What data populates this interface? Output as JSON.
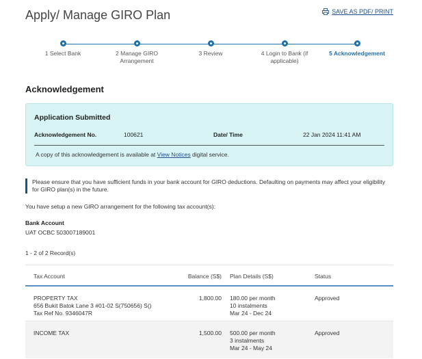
{
  "header": {
    "title": "Apply/ Manage GIRO Plan",
    "save_label": "SAVE AS PDF/ PRINT"
  },
  "stepper": {
    "steps": [
      {
        "line1": "1 Select Bank",
        "line2": ""
      },
      {
        "line1": "2 Manage GIRO",
        "line2": "Arrangement"
      },
      {
        "line1": "3 Review",
        "line2": ""
      },
      {
        "line1": "4 Login to Bank (if",
        "line2": "applicable)"
      },
      {
        "line1": "5 Acknowledgement",
        "line2": ""
      }
    ],
    "active_index": 4,
    "color": "#1f6fa8"
  },
  "section_title": "Acknowledgement",
  "ack": {
    "title": "Application Submitted",
    "ack_no_label": "Acknowledgement No.",
    "ack_no_value": "100621",
    "datetime_label": "Date/ Time",
    "datetime_value": "22 Jan 2024 11:41 AM",
    "note_before": "A copy of this acknowledgement is available at ",
    "note_link": "View Notices",
    "note_after": " digital service.",
    "bg_color": "#d8f3f3"
  },
  "info_text": "Please ensure that you have sufficient funds in your bank account for GIRO deductions. Defaulting on payments may affect your eligibility for GIRO plan(s) in the future.",
  "setup_text": "You have setup a new GIRO arrangement for the following tax account(s):",
  "bank": {
    "label": "Bank Account",
    "value": "UAT OCBC 503007189001"
  },
  "record_count": "1 - 2 of 2 Record(s)",
  "table": {
    "headers": {
      "account": "Tax Account",
      "balance": "Balance (S$)",
      "plan": "Plan Details (S$)",
      "status": "Status"
    },
    "rows": [
      {
        "account": [
          "PROPERTY TAX",
          "656 Bukit Batok Lane 3 #01-02 S(750656) S()",
          "Tax Ref No. 9346047R"
        ],
        "balance": "1,800.00",
        "plan": [
          "180.00 per month",
          "10 instalments",
          "Mar 24 - Dec 24"
        ],
        "status": "Approved"
      },
      {
        "account": [
          "INCOME TAX"
        ],
        "balance": "1,500.00",
        "plan": [
          "500.00 per month",
          "3 instalments",
          "Mar 24 - May 24"
        ],
        "status": "Approved"
      }
    ]
  },
  "icons": {
    "print": "printer-icon"
  }
}
